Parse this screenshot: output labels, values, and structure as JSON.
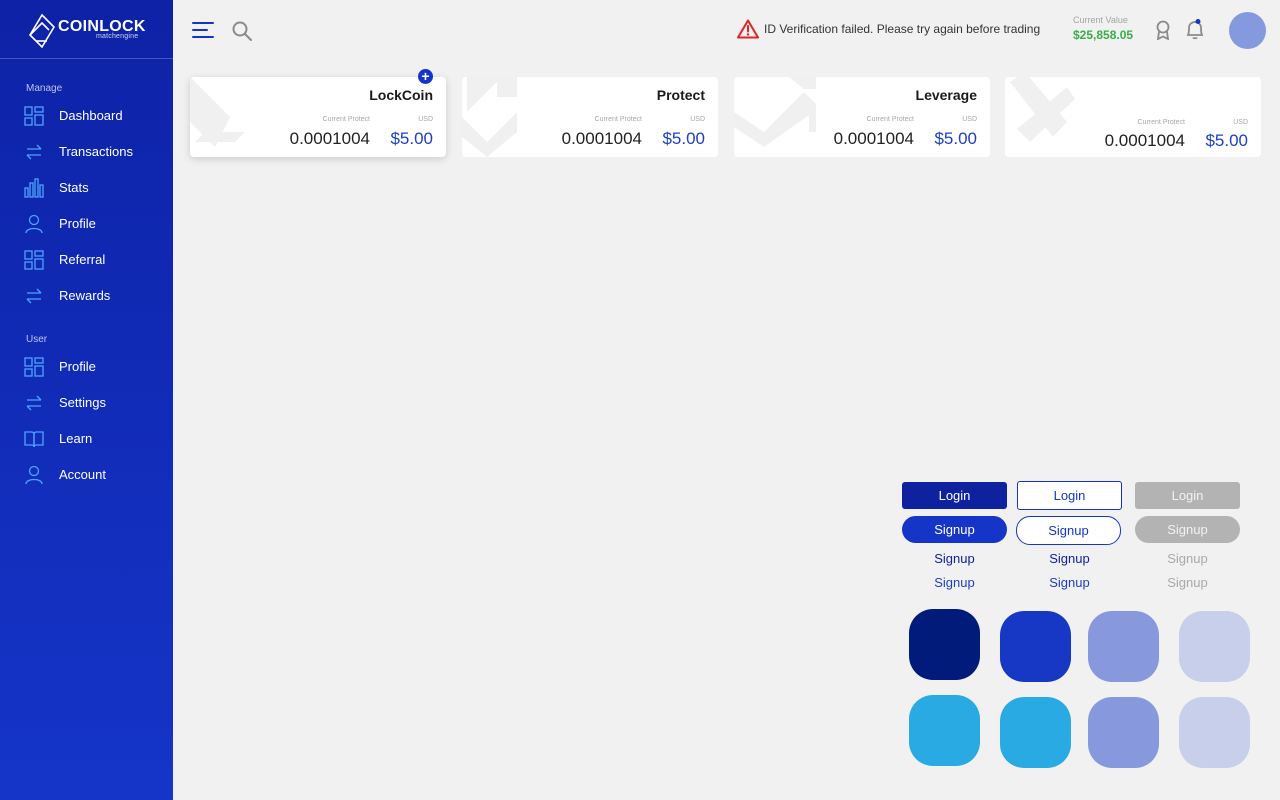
{
  "brand": {
    "name": "COINLOCK",
    "sub": "matchengine"
  },
  "sidebar": {
    "sections": [
      {
        "label": "Manage",
        "items": [
          {
            "label": "Dashboard",
            "icon": "grid-icon"
          },
          {
            "label": "Transactions",
            "icon": "arrows-exchange-icon"
          },
          {
            "label": "Stats",
            "icon": "bar-chart-icon"
          },
          {
            "label": "Profile",
            "icon": "user-icon"
          },
          {
            "label": "Referral",
            "icon": "grid-icon"
          },
          {
            "label": "Rewards",
            "icon": "arrows-exchange-icon"
          }
        ]
      },
      {
        "label": "User",
        "items": [
          {
            "label": "Profile",
            "icon": "grid-icon"
          },
          {
            "label": "Settings",
            "icon": "arrows-exchange-icon"
          },
          {
            "label": "Learn",
            "icon": "book-icon"
          },
          {
            "label": "Account",
            "icon": "user-icon"
          }
        ]
      }
    ]
  },
  "header": {
    "alert": "ID Verification failed. Please try again before trading",
    "current_value_label": "Current Value",
    "current_value": "$25,858.05"
  },
  "cards": [
    {
      "title": "LockCoin",
      "cp_label": "Current Protect",
      "usd_label": "USD",
      "amount": "0.0001004",
      "price": "$5.00",
      "add": "+"
    },
    {
      "title": "Protect",
      "cp_label": "Current Protect",
      "usd_label": "USD",
      "amount": "0.0001004",
      "price": "$5.00"
    },
    {
      "title": "Leverage",
      "cp_label": "Current Protect",
      "usd_label": "USD",
      "amount": "0.0001004",
      "price": "$5.00"
    },
    {
      "title": "",
      "cp_label": "Current Protect",
      "usd_label": "USD",
      "amount": "0.0001004",
      "price": "$5.00"
    }
  ],
  "buttons": {
    "login": "Login",
    "signup": "Signup"
  },
  "colors": {
    "navy": "#001b7a",
    "blue": "#1738c4",
    "periwinkle": "#8799dc",
    "lavender": "#c7cfea",
    "sky": "#29aae2"
  }
}
